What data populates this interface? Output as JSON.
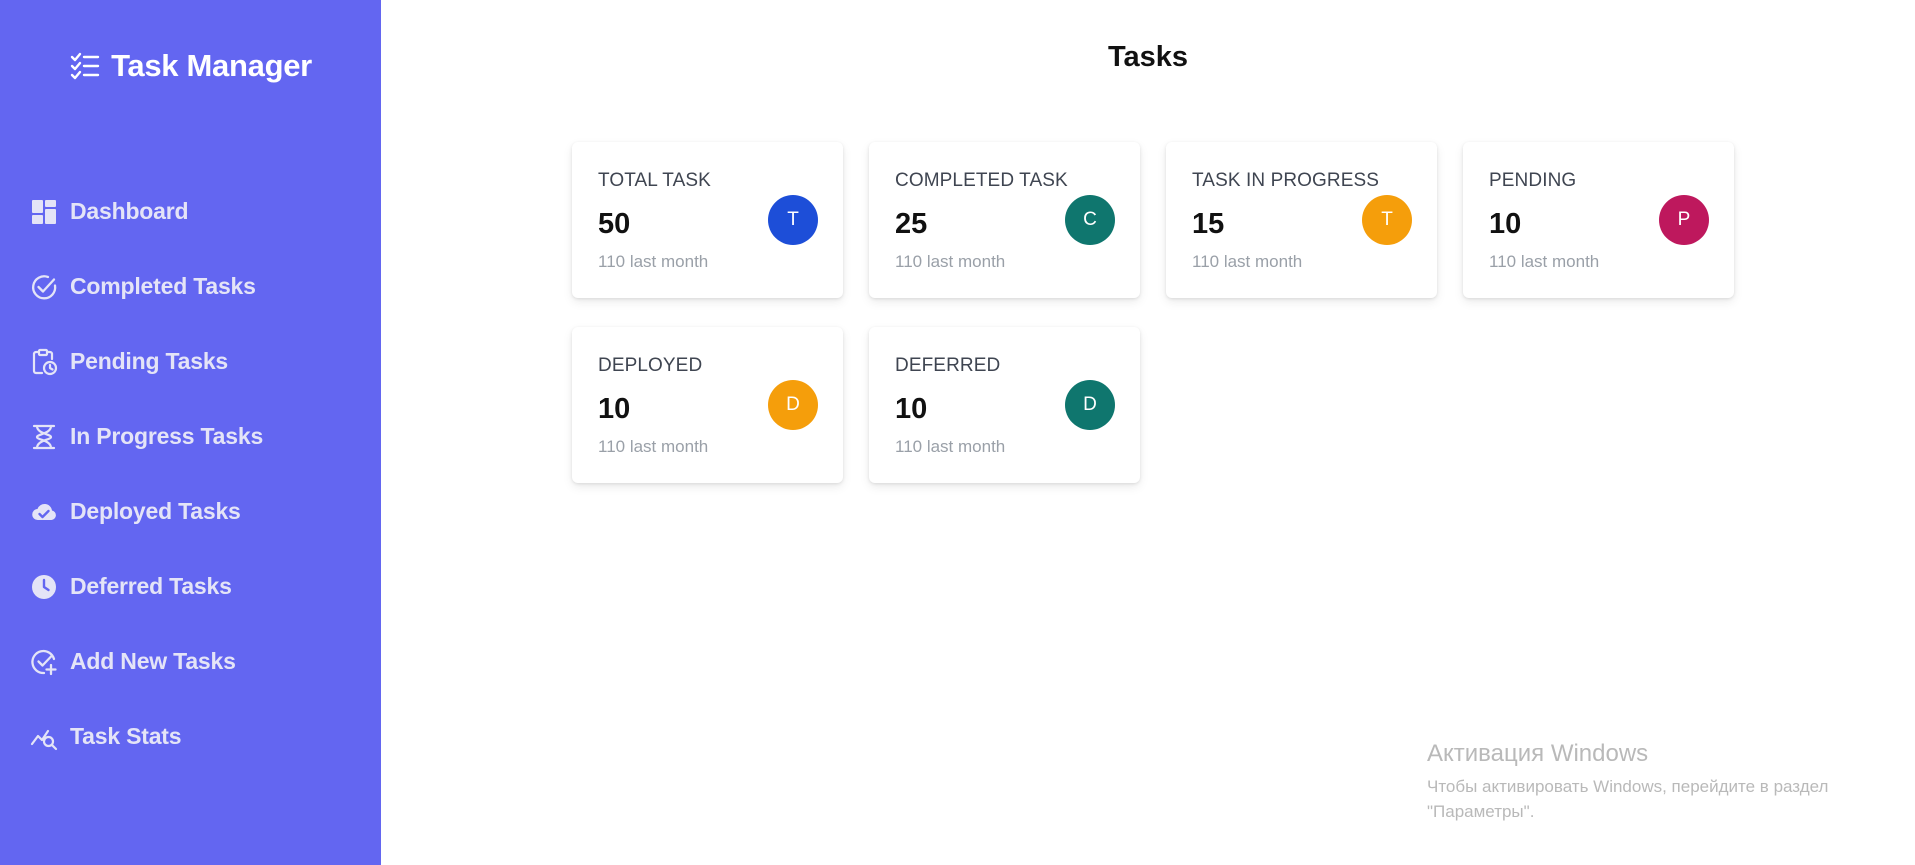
{
  "sidebar": {
    "brand": "Task Manager",
    "brand_icon": "checklist-icon",
    "color": "#6366f1",
    "items": [
      {
        "label": "Dashboard",
        "icon": "dashboard-icon"
      },
      {
        "label": "Completed Tasks",
        "icon": "check-circle-icon"
      },
      {
        "label": "Pending Tasks",
        "icon": "clipboard-clock-icon"
      },
      {
        "label": "In Progress Tasks",
        "icon": "hourglass-icon"
      },
      {
        "label": "Deployed Tasks",
        "icon": "cloud-check-icon"
      },
      {
        "label": "Deferred Tasks",
        "icon": "clock-icon"
      },
      {
        "label": "Add New Tasks",
        "icon": "check-add-icon"
      },
      {
        "label": "Task Stats",
        "icon": "stats-search-icon"
      }
    ]
  },
  "main": {
    "title": "Tasks",
    "cards": [
      {
        "label": "TOTAL TASK",
        "value": "50",
        "sub": "110 last month",
        "avatar": "T",
        "color": "#1d4ed8"
      },
      {
        "label": "COMPLETED TASK",
        "value": "25",
        "sub": "110 last month",
        "avatar": "C",
        "color": "#0f766e"
      },
      {
        "label": "TASK IN PROGRESS",
        "value": "15",
        "sub": "110 last month",
        "avatar": "T",
        "color": "#f59e0b"
      },
      {
        "label": "PENDING",
        "value": "10",
        "sub": "110 last month",
        "avatar": "P",
        "color": "#be185d"
      },
      {
        "label": "DEPLOYED",
        "value": "10",
        "sub": "110 last month",
        "avatar": "D",
        "color": "#f59e0b"
      },
      {
        "label": "DEFERRED",
        "value": "10",
        "sub": "110 last month",
        "avatar": "D",
        "color": "#0f766e"
      }
    ]
  },
  "watermark": {
    "title": "Активация Windows",
    "text": "Чтобы активировать Windows, перейдите в раздел \"Параметры\"."
  }
}
